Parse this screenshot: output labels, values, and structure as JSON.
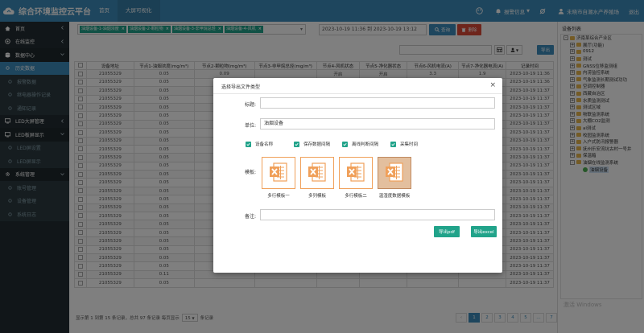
{
  "app": {
    "title": "综合环境监控云平台"
  },
  "topnav": [
    {
      "label": "首页"
    },
    {
      "label": "大屏可视化"
    }
  ],
  "topright": {
    "alarm": "报警信息",
    "user": "未晓市自潮水产养殖场",
    "logout": "退出"
  },
  "sidebar": [
    {
      "label": "首页",
      "icon": "home-icon",
      "kind": "group"
    },
    {
      "label": "在线监控",
      "icon": "monitor-icon",
      "kind": "group"
    },
    {
      "label": "数据中心",
      "icon": "database-icon",
      "kind": "open"
    },
    {
      "label": "历史数据",
      "icon": "circle-icon",
      "kind": "active"
    },
    {
      "label": "报警数据",
      "icon": "circle-icon",
      "kind": "sub"
    },
    {
      "label": "继电器操作记录",
      "icon": "circle-icon",
      "kind": "sub"
    },
    {
      "label": "通知记录",
      "icon": "circle-icon",
      "kind": "sub"
    },
    {
      "label": "LED大屏管理",
      "icon": "screen-icon",
      "kind": "group"
    },
    {
      "label": "LED板屏显示",
      "icon": "screen-icon",
      "kind": "open"
    },
    {
      "label": "LED屏设置",
      "icon": "circle-icon",
      "kind": "sub"
    },
    {
      "label": "LED屏显示",
      "icon": "circle-icon",
      "kind": "sub"
    },
    {
      "label": "系统管理",
      "icon": "gear-icon",
      "kind": "open"
    },
    {
      "label": "账号管理",
      "icon": "circle-icon",
      "kind": "sub"
    },
    {
      "label": "设备管理",
      "icon": "circle-icon",
      "kind": "sub"
    },
    {
      "label": "系统日志",
      "icon": "circle-icon",
      "kind": "sub"
    }
  ],
  "filters": {
    "tags": [
      "油烟设备-1-油烟浓度",
      "油烟设备-2-颗粒物",
      "油烟设备-3-非甲烷总烃",
      "油烟设备-4-风机"
    ],
    "daterange": "2023-10-19 11:36 到 2023-10-19 13:12",
    "query_label": "查询",
    "delete_label": "删除"
  },
  "toolbar": {
    "export_label": "导出"
  },
  "table": {
    "headers": [
      "设备地址",
      "节点1-油烟浓度(mg/m³)",
      "节点2-颗粒物(mg/m³)",
      "节点3-非甲烷总烃(mg/m³)",
      "节点4-风机状态",
      "节点5-净化器状态",
      "节点6-风机电流(A)",
      "节点7-净化器电流(A)",
      "记录时间"
    ],
    "rows": [
      [
        "21055329",
        "0.05",
        "0.09",
        "",
        "开启",
        "开启",
        "3.3",
        "1.9",
        "2023-10-19 11:36"
      ],
      [
        "21055329",
        "0.05",
        "",
        "",
        "",
        "",
        "",
        "",
        "2023-10-19 11:36"
      ],
      [
        "21055329",
        "0.05",
        "",
        "",
        "",
        "",
        "",
        "",
        "2023-10-19 11:37"
      ],
      [
        "21055329",
        "0.05",
        "",
        "",
        "",
        "",
        "",
        "",
        "2023-10-19 11:37"
      ],
      [
        "21055329",
        "0.05",
        "",
        "",
        "",
        "",
        "",
        "",
        "2023-10-19 11:37"
      ],
      [
        "21055329",
        "0.05",
        "",
        "",
        "",
        "",
        "",
        "",
        "2023-10-19 11:37"
      ],
      [
        "21055329",
        "0.05",
        "",
        "",
        "",
        "",
        "",
        "",
        "2023-10-19 11:37"
      ],
      [
        "21055329",
        "0.05",
        "",
        "",
        "",
        "",
        "",
        "",
        "2023-10-19 11:37"
      ],
      [
        "21055329",
        "0.05",
        "",
        "",
        "",
        "",
        "",
        "",
        "2023-10-19 11:37"
      ],
      [
        "21055329",
        "0.05",
        "",
        "",
        "",
        "",
        "",
        "",
        "2023-10-19 11:37"
      ],
      [
        "21055329",
        "0.05",
        "",
        "",
        "",
        "",
        "",
        "",
        "2023-10-19 11:37"
      ],
      [
        "21055329",
        "0.05",
        "",
        "",
        "",
        "",
        "",
        "",
        "2023-10-19 11:37"
      ],
      [
        "21055329",
        "0.05",
        "",
        "",
        "",
        "",
        "",
        "",
        "2023-10-19 11:37"
      ],
      [
        "21055329",
        "0.05",
        "",
        "",
        "",
        "",
        "",
        "",
        "2023-10-19 11:37"
      ],
      [
        "21055329",
        "0.05",
        "",
        "",
        "",
        "",
        "",
        "",
        "2023-10-19 11:37"
      ],
      [
        "21055329",
        "0.05",
        "",
        "",
        "",
        "",
        "",
        "",
        "2023-10-19 11:37"
      ],
      [
        "21055329",
        "0.05",
        "",
        "",
        "",
        "",
        "",
        "",
        "2023-10-19 11:37"
      ],
      [
        "21055329",
        "0.05",
        "",
        "",
        "",
        "",
        "",
        "",
        "2023-10-19 11:37"
      ],
      [
        "21055329",
        "0.05",
        "",
        "",
        "",
        "",
        "",
        "",
        "2023-10-19 11:37"
      ],
      [
        "21055329",
        "0.05",
        "",
        "",
        "",
        "",
        "",
        "",
        "2023-10-19 11:37"
      ],
      [
        "21055329",
        "0.05",
        "",
        "",
        "",
        "",
        "",
        "",
        "2023-10-19 11:37"
      ],
      [
        "21055329",
        "0.05",
        "",
        "",
        "",
        "",
        "",
        "",
        "2023-10-19 11:37"
      ],
      [
        "21055329",
        "0.05",
        "",
        "",
        "",
        "",
        "",
        "",
        "2023-10-19 11:37"
      ],
      [
        "21055329",
        "0.05",
        "",
        "",
        "",
        "",
        "",
        "",
        "2023-10-19 11:37"
      ],
      [
        "21055329",
        "0.11",
        "",
        "",
        "",
        "",
        "",
        "",
        "2023-10-19 11:37"
      ],
      [
        "21055329",
        "0.05",
        "",
        "",
        "",
        "",
        "",
        "",
        "2023-10-19 11:37"
      ]
    ]
  },
  "footer": {
    "info_prefix": "显示第 1 到第 15 条记录，总共 97 条记录 每页显示",
    "page_size": "15",
    "info_suffix": "条记录",
    "pages": [
      "‹",
      "1",
      "2",
      "3",
      "4",
      "5",
      "…",
      "7",
      "›"
    ],
    "active_page": "1"
  },
  "watermark": "激活 Windows",
  "devlist": {
    "title": "设备列表",
    "tree": [
      {
        "label": "济南某综合产业区",
        "depth": 0,
        "type": "folder",
        "pm": "-"
      },
      {
        "label": "展厅(功能)",
        "depth": 1,
        "type": "folder",
        "pm": "+"
      },
      {
        "label": "0912",
        "depth": 1,
        "type": "folder",
        "pm": "+"
      },
      {
        "label": "测试",
        "depth": 1,
        "type": "folder",
        "pm": "+"
      },
      {
        "label": "GNSS位移监测组",
        "depth": 1,
        "type": "folder",
        "pm": "+"
      },
      {
        "label": "内涝监控系统",
        "depth": 1,
        "type": "folder",
        "pm": "+"
      },
      {
        "label": "气象监测长期测试功功",
        "depth": 1,
        "type": "folder",
        "pm": "+"
      },
      {
        "label": "空调控制器",
        "depth": 1,
        "type": "folder",
        "pm": "+"
      },
      {
        "label": "西藏自治区",
        "depth": 1,
        "type": "folder",
        "pm": "+"
      },
      {
        "label": "水质监测测试",
        "depth": 1,
        "type": "folder",
        "pm": "+"
      },
      {
        "label": "测试区域",
        "depth": 1,
        "type": "folder",
        "pm": "+"
      },
      {
        "label": "物联监测系统",
        "depth": 1,
        "type": "folder",
        "pm": "+"
      },
      {
        "label": "大棚CO2监测",
        "depth": 1,
        "type": "folder",
        "pm": "+"
      },
      {
        "label": "al测试",
        "depth": 1,
        "type": "folder",
        "pm": "+"
      },
      {
        "label": "校园监测系统",
        "depth": 1,
        "type": "folder",
        "pm": "+"
      },
      {
        "label": "入户式防汛报警器",
        "depth": 1,
        "type": "folder",
        "pm": "+"
      },
      {
        "label": "抚州乐安流坑古村一号井",
        "depth": 1,
        "type": "folder",
        "pm": "+"
      },
      {
        "label": "保温箱",
        "depth": 1,
        "type": "folder",
        "pm": "+"
      },
      {
        "label": "油烟在线监测系统",
        "depth": 1,
        "type": "folder",
        "pm": "-"
      },
      {
        "label": "油烟设备",
        "depth": 2,
        "type": "leaf",
        "pm": ""
      }
    ]
  },
  "modal": {
    "title": "选择导出文件类型",
    "fields": {
      "title_label": "标题:",
      "title_value": "",
      "unit_label": "单位:",
      "unit_value": "油烟设备",
      "template_label": "模板:",
      "note_label": "备注:",
      "note_value": ""
    },
    "checkboxes": [
      "设备名称",
      "保存数据间隔",
      "离线判断间隔",
      "采集时间"
    ],
    "templates": [
      "多行模板一",
      "多列模板",
      "多行模板二",
      "温湿度数据模板"
    ],
    "buttons": {
      "pdf": "导出pdf",
      "excel": "导出excel"
    },
    "colors": {
      "accent": "#21a38a",
      "template_border": "#f0a05a"
    }
  },
  "colors": {
    "topbar": "#3c8dbc",
    "sidebar": "#222d32",
    "danger": "#dd4b39"
  }
}
